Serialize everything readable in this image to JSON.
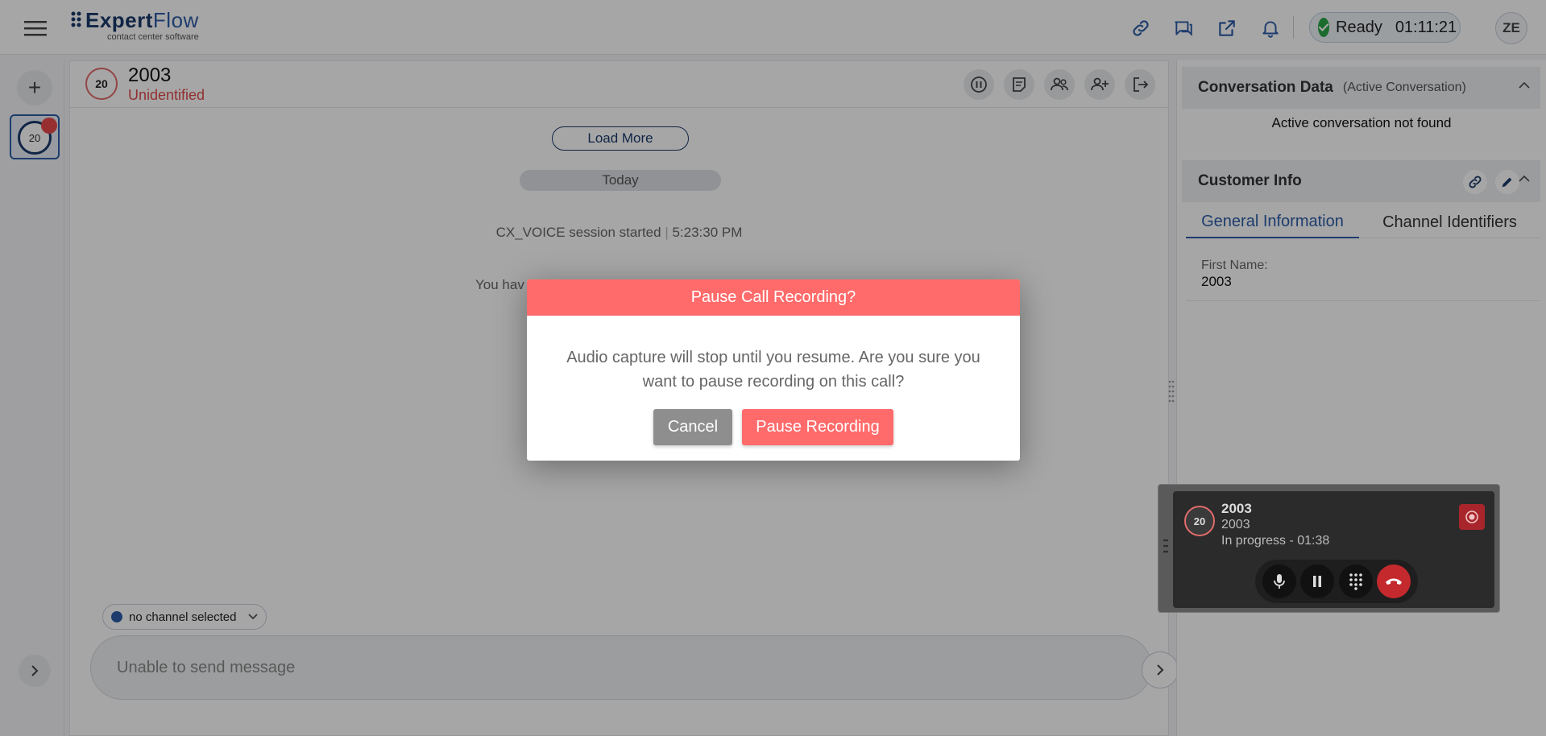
{
  "app": {
    "logo_text_main": "Expert",
    "logo_text_accent": "Flow",
    "logo_subtitle": "contact center software"
  },
  "topbar": {
    "icons": [
      "link-icon",
      "chat-icon",
      "share-icon",
      "bell-icon"
    ],
    "status": {
      "label": "Ready",
      "timer": "01:11:21",
      "color": "#28a745"
    },
    "user_initials": "ZE"
  },
  "left_rail": {
    "add_label": "+",
    "conversation_badge": "20"
  },
  "conversation": {
    "avatar": "20",
    "name": "2003",
    "subtitle": "Unidentified",
    "actions": [
      "pause-icon",
      "notes-icon",
      "participants-icon",
      "add-participant-icon",
      "leave-icon"
    ],
    "load_more": "Load More",
    "date_divider": "Today",
    "system_message": "CX_VOICE session started",
    "system_time": "5:23:30 PM",
    "partial_message": "You hav",
    "channel_select": "no channel selected",
    "compose_placeholder": "Unable to send message"
  },
  "right_panel": {
    "conversation_data": {
      "title": "Conversation Data",
      "subtitle": "(Active Conversation)",
      "empty": "Active conversation not found"
    },
    "customer_info": {
      "title": "Customer Info",
      "tabs": [
        {
          "label": "General Information",
          "active": true
        },
        {
          "label": "Channel Identifiers",
          "active": false
        }
      ],
      "fields": [
        {
          "label": "First Name:",
          "value": "2003"
        }
      ]
    }
  },
  "call_widget": {
    "avatar": "20",
    "name": "2003",
    "number": "2003",
    "status": "In progress - 01:38",
    "controls": [
      "mic-icon",
      "hold-icon",
      "dialpad-icon",
      "end-call-icon"
    ]
  },
  "modal": {
    "title": "Pause Call Recording?",
    "body": "Audio capture will stop until you resume. Are you sure you want to pause recording on this call?",
    "cancel_label": "Cancel",
    "confirm_label": "Pause Recording",
    "accent": "#ff6b6b"
  }
}
